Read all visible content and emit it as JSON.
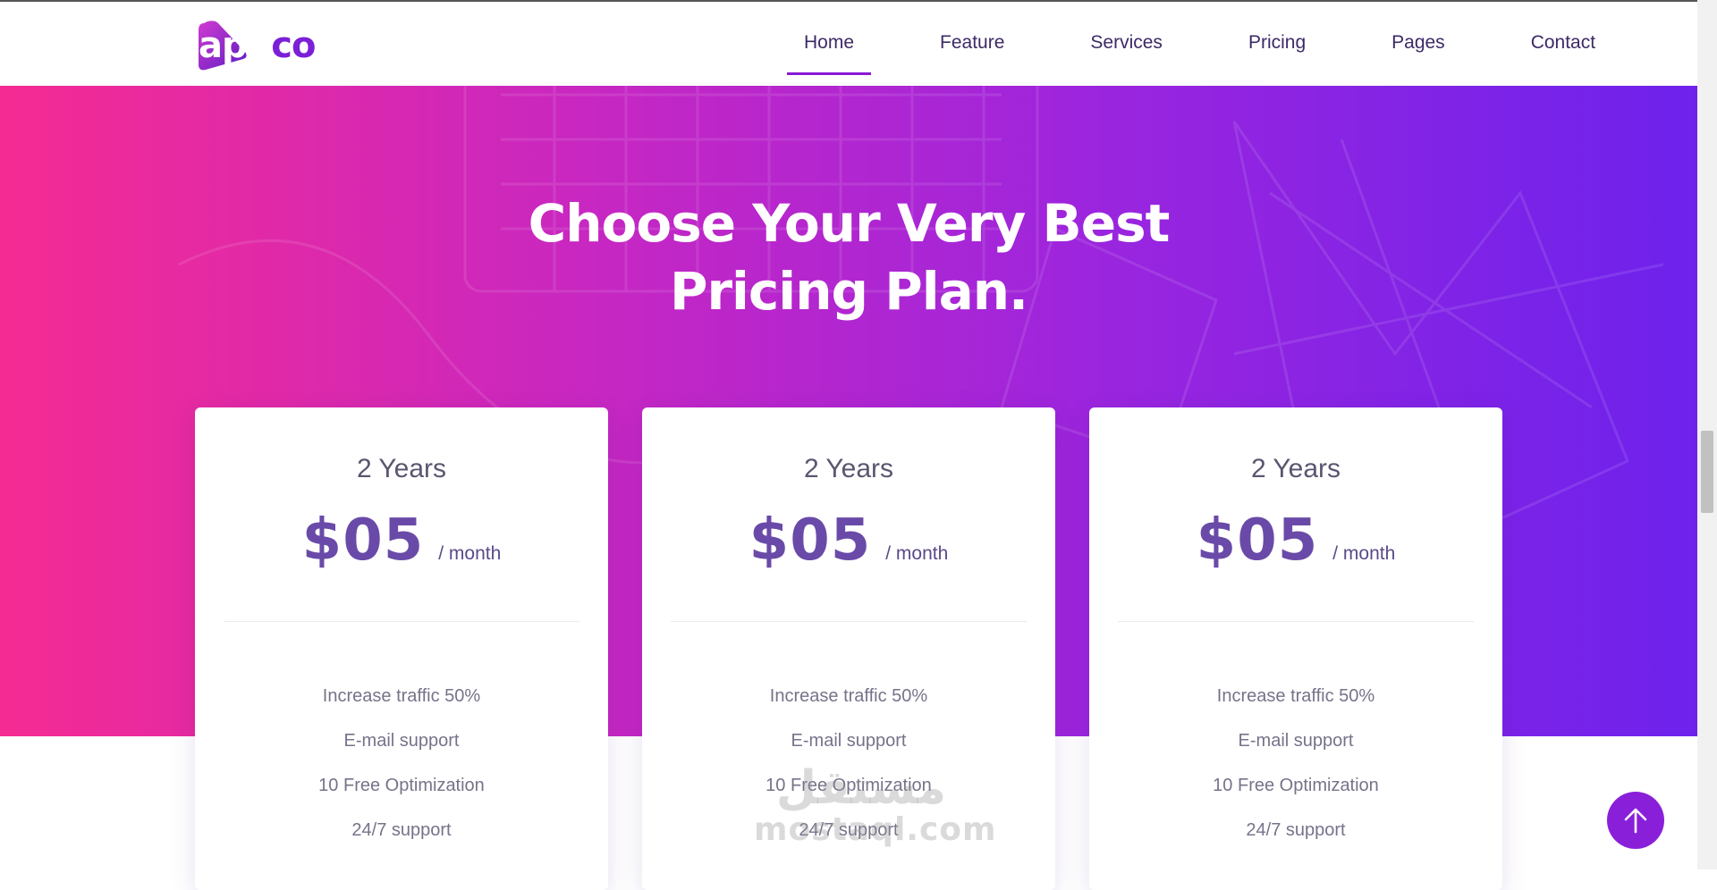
{
  "logo": {
    "part1": "app",
    "part2": "co"
  },
  "nav": {
    "items": [
      {
        "label": "Home",
        "active": true
      },
      {
        "label": "Feature",
        "active": false
      },
      {
        "label": "Services",
        "active": false
      },
      {
        "label": "Pricing",
        "active": false
      },
      {
        "label": "Pages",
        "active": false
      },
      {
        "label": "Contact",
        "active": false
      }
    ]
  },
  "hero": {
    "title_line1": "Choose Your Very Best",
    "title_line2": "Pricing Plan."
  },
  "plans": [
    {
      "term": "2 Years",
      "price": "$05",
      "period": "/ month",
      "features": [
        "Increase traffic 50%",
        "E-mail support",
        "10 Free Optimization",
        "24/7 support"
      ]
    },
    {
      "term": "2 Years",
      "price": "$05",
      "period": "/ month",
      "features": [
        "Increase traffic 50%",
        "E-mail support",
        "10 Free Optimization",
        "24/7 support"
      ]
    },
    {
      "term": "2 Years",
      "price": "$05",
      "period": "/ month",
      "features": [
        "Increase traffic 50%",
        "E-mail support",
        "10 Free Optimization",
        "24/7 support"
      ]
    }
  ],
  "watermark": {
    "arabic": "مستقل",
    "latin": "mostaql.com"
  },
  "icons": {
    "back_to_top": "arrow-up-icon"
  },
  "colors": {
    "gradient_start": "#f52b92",
    "gradient_end": "#6d22ec",
    "accent": "#8a1ad6",
    "price": "#6a4aa8",
    "nav_text": "#3d2a66"
  }
}
